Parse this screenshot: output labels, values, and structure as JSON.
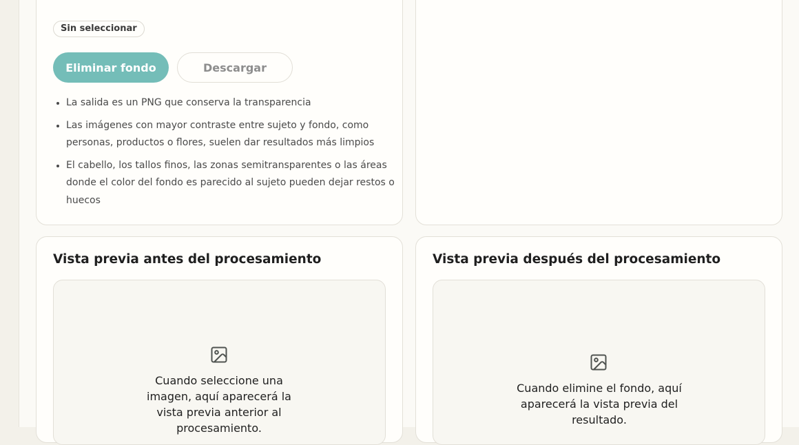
{
  "options": {
    "status_badge": "Sin seleccionar",
    "remove_button": "Eliminar fondo",
    "download_button": "Descargar",
    "notes": [
      "La salida es un PNG que conserva la transparencia",
      "Las imágenes con mayor contraste entre sujeto y fondo, como personas, productos o flores, suelen dar resultados más limpios",
      "El cabello, los tallos finos, las zonas semitransparentes o las áreas donde el color del fondo es parecido al sujeto pueden dejar restos o huecos"
    ]
  },
  "preview_before": {
    "title": "Vista previa antes del procesamiento",
    "icon": "image-icon",
    "empty_text": "Cuando seleccione una imagen, aquí aparecerá la vista previa anterior al procesamiento."
  },
  "preview_after": {
    "title": "Vista previa después del procesamiento",
    "icon": "image-icon",
    "empty_text": "Cuando elimine el fondo, aquí aparecerá la vista previa del resultado."
  },
  "colors": {
    "accent": "#74bdb8",
    "page_background": "#fbfaf6",
    "card_background": "#fffefb",
    "border": "#e3e0d8"
  }
}
